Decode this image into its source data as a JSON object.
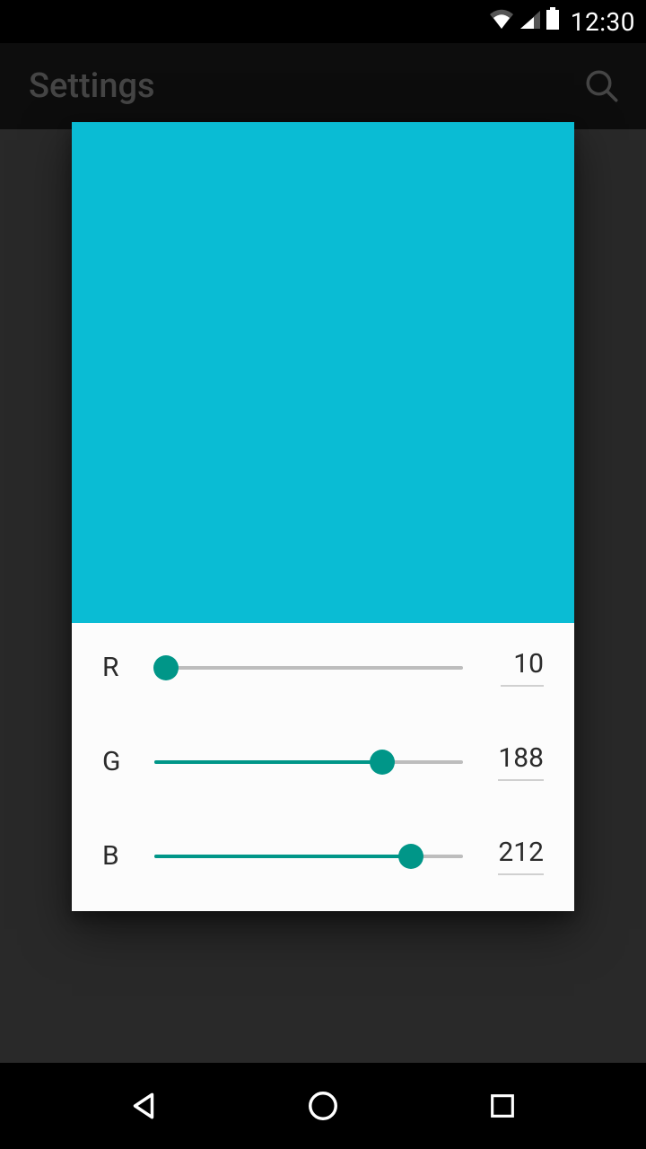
{
  "status": {
    "time": "12:30"
  },
  "appbar": {
    "title": "Settings"
  },
  "color_picker": {
    "preview_color": "#0abcd4",
    "accent_color": "#009688",
    "channels": [
      {
        "label": "R",
        "value": 10,
        "max": 255
      },
      {
        "label": "G",
        "value": 188,
        "max": 255
      },
      {
        "label": "B",
        "value": 212,
        "max": 255
      }
    ]
  }
}
